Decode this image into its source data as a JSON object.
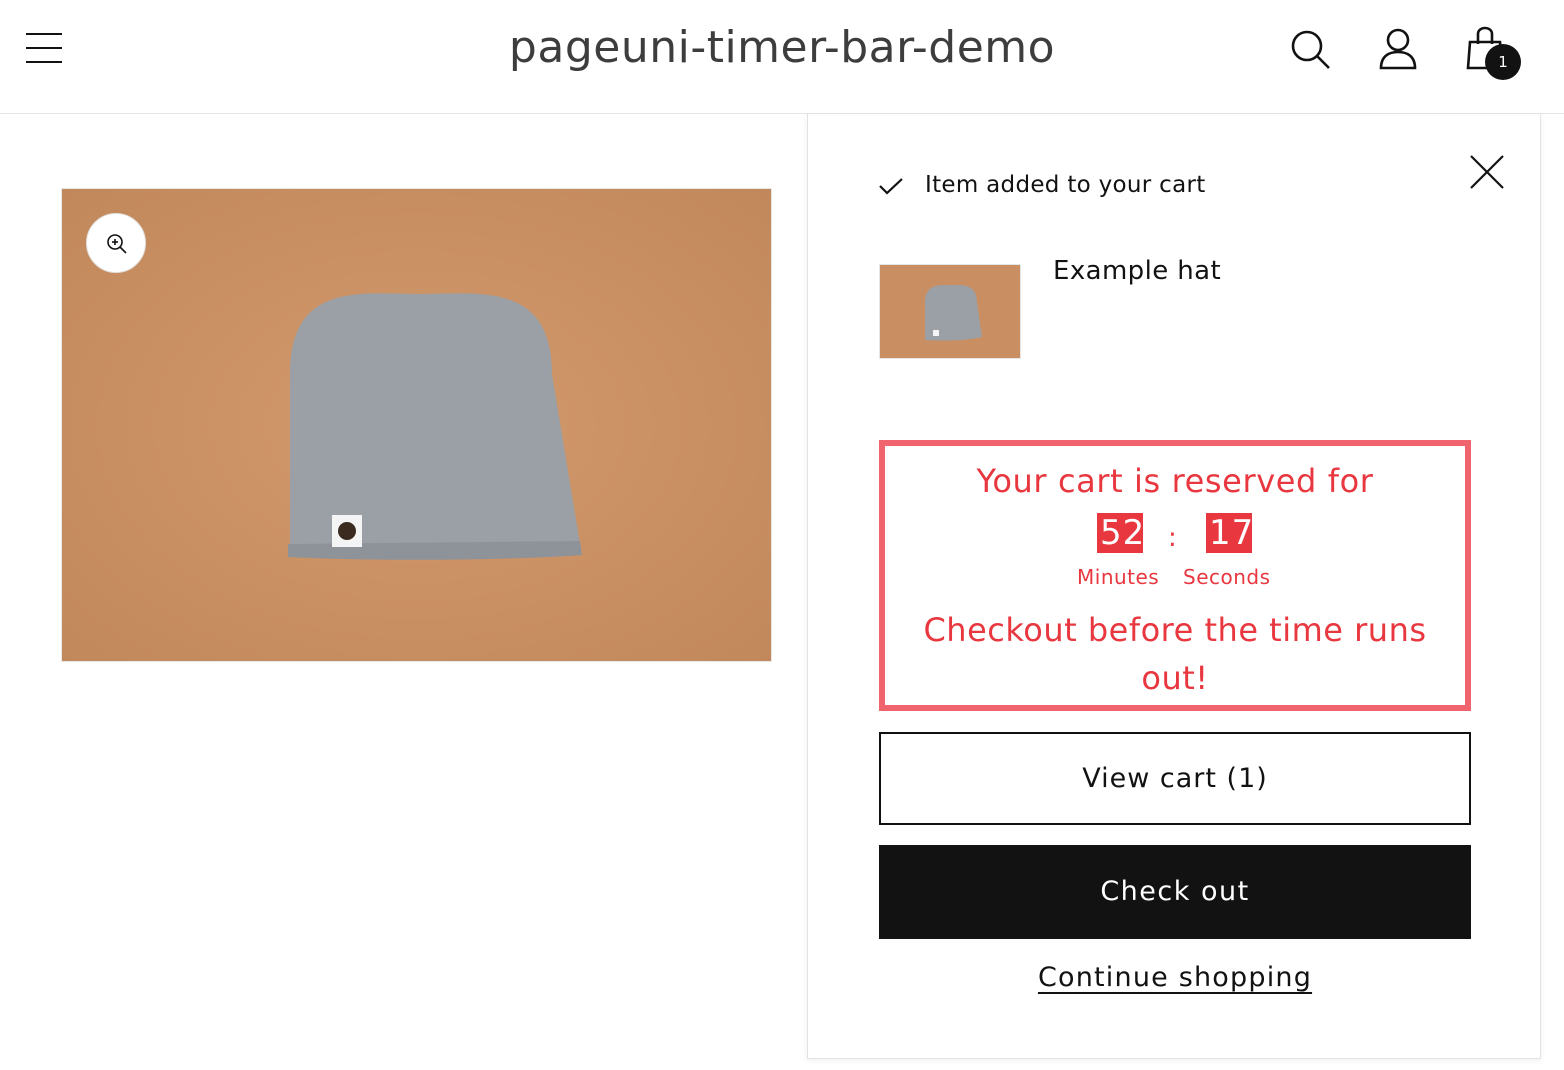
{
  "header": {
    "title": "pageuni-timer-bar-demo",
    "cart_count": "1",
    "icons": [
      "menu-icon",
      "search-icon",
      "account-icon",
      "cart-icon"
    ]
  },
  "product_media": {
    "zoom_icon": "zoom-in-icon"
  },
  "cart_drawer": {
    "added_text": "Item added to your cart",
    "close_icon": "close-icon",
    "item_name": "Example hat",
    "timer": {
      "heading": "Your cart is reserved for",
      "minutes": "52",
      "seconds": "17",
      "separator": ":",
      "minutes_label": "Minutes",
      "seconds_label": "Seconds",
      "footer": "Checkout before the time runs out!",
      "color": "#e8373f",
      "border_color": "#f0646e"
    },
    "view_cart_label": "View cart (1)",
    "checkout_label": "Check out",
    "continue_label": "Continue shopping"
  },
  "colors": {
    "primary_text": "#121212",
    "button_dark": "#121212",
    "image_background": "#c98f62",
    "hat_color": "#9aa0a6"
  }
}
